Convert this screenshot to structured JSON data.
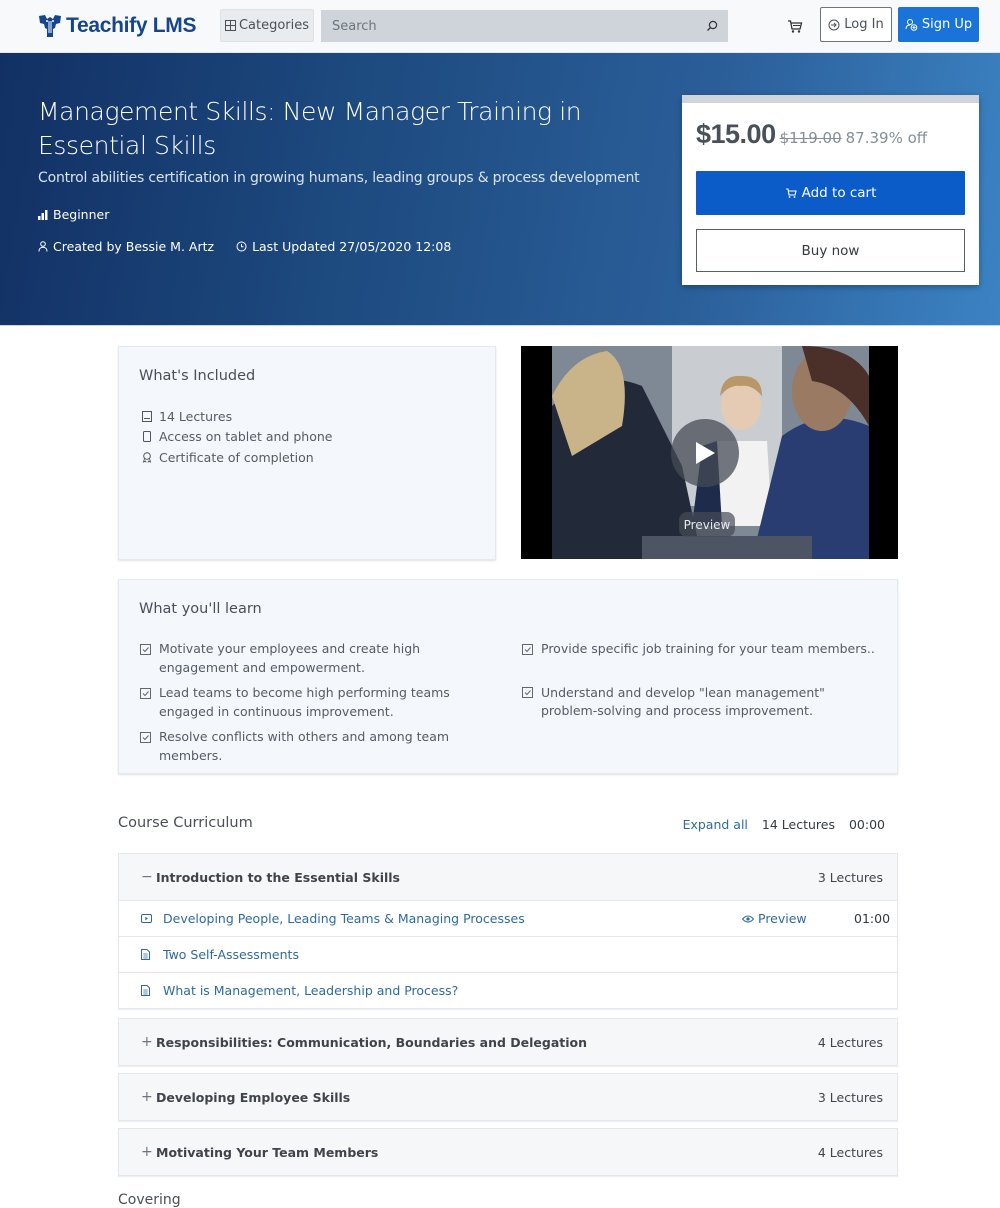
{
  "header": {
    "brand": "Teachify LMS",
    "categories_label": "Categories",
    "search_placeholder": "Search",
    "login_label": "Log In",
    "signup_label": "Sign Up"
  },
  "course": {
    "title": "Management Skills: New Manager Training in Essential Skills",
    "subtitle": "Control abilities certification in growing humans, leading groups & process development",
    "level": "Beginner",
    "created_by": "Created by Bessie M. Artz",
    "last_updated": "Last Updated 27/05/2020 12:08"
  },
  "pricing": {
    "price": "$15.00",
    "original_price": "$119.00",
    "discount": "87.39% off",
    "add_to_cart_label": "Add to cart",
    "buy_now_label": "Buy now"
  },
  "included": {
    "title": "What's Included",
    "items": [
      {
        "icon": "lectures-icon",
        "label": "14 Lectures"
      },
      {
        "icon": "tablet-icon",
        "label": "Access on tablet and phone"
      },
      {
        "icon": "certificate-icon",
        "label": "Certificate of completion"
      }
    ]
  },
  "video": {
    "preview_label": "Preview"
  },
  "learn": {
    "title": "What you'll learn",
    "left": [
      "Motivate your employees and create high engagement and empowerment.",
      "Lead teams to become high performing teams engaged in continuous improvement.",
      "Resolve conflicts with others and among team members."
    ],
    "right": [
      "Provide specific job training for your team members..",
      "Understand and develop \"lean management\" problem-solving and process improvement."
    ]
  },
  "curriculum": {
    "title": "Course Curriculum",
    "expand_all_label": "Expand all",
    "total_lectures": "14 Lectures",
    "total_duration": "00:00",
    "sections": [
      {
        "toggle": "−",
        "name": "Introduction to the Essential Skills",
        "count": "3 Lectures",
        "expanded": true,
        "lectures": [
          {
            "type": "video",
            "name": "Developing People, Leading Teams & Managing Processes",
            "preview": "Preview",
            "duration": "01:00"
          },
          {
            "type": "document",
            "name": "Two Self-Assessments",
            "preview": "",
            "duration": ""
          },
          {
            "type": "document",
            "name": "What is Management, Leadership and Process?",
            "preview": "",
            "duration": ""
          }
        ]
      },
      {
        "toggle": "+",
        "name": "Responsibilities: Communication, Boundaries and Delegation",
        "count": "4 Lectures",
        "expanded": false
      },
      {
        "toggle": "+",
        "name": "Developing Employee Skills",
        "count": "3 Lectures",
        "expanded": false
      },
      {
        "toggle": "+",
        "name": "Motivating Your Team Members",
        "count": "4 Lectures",
        "expanded": false
      }
    ]
  },
  "next_section_partial": "Covering",
  "colors": {
    "brand": "#15458f",
    "primary": "#0b5cc9",
    "signup": "#1a73d9",
    "link": "#2e6aa0",
    "hero_start": "#123064",
    "hero_end": "#3c83c4"
  }
}
